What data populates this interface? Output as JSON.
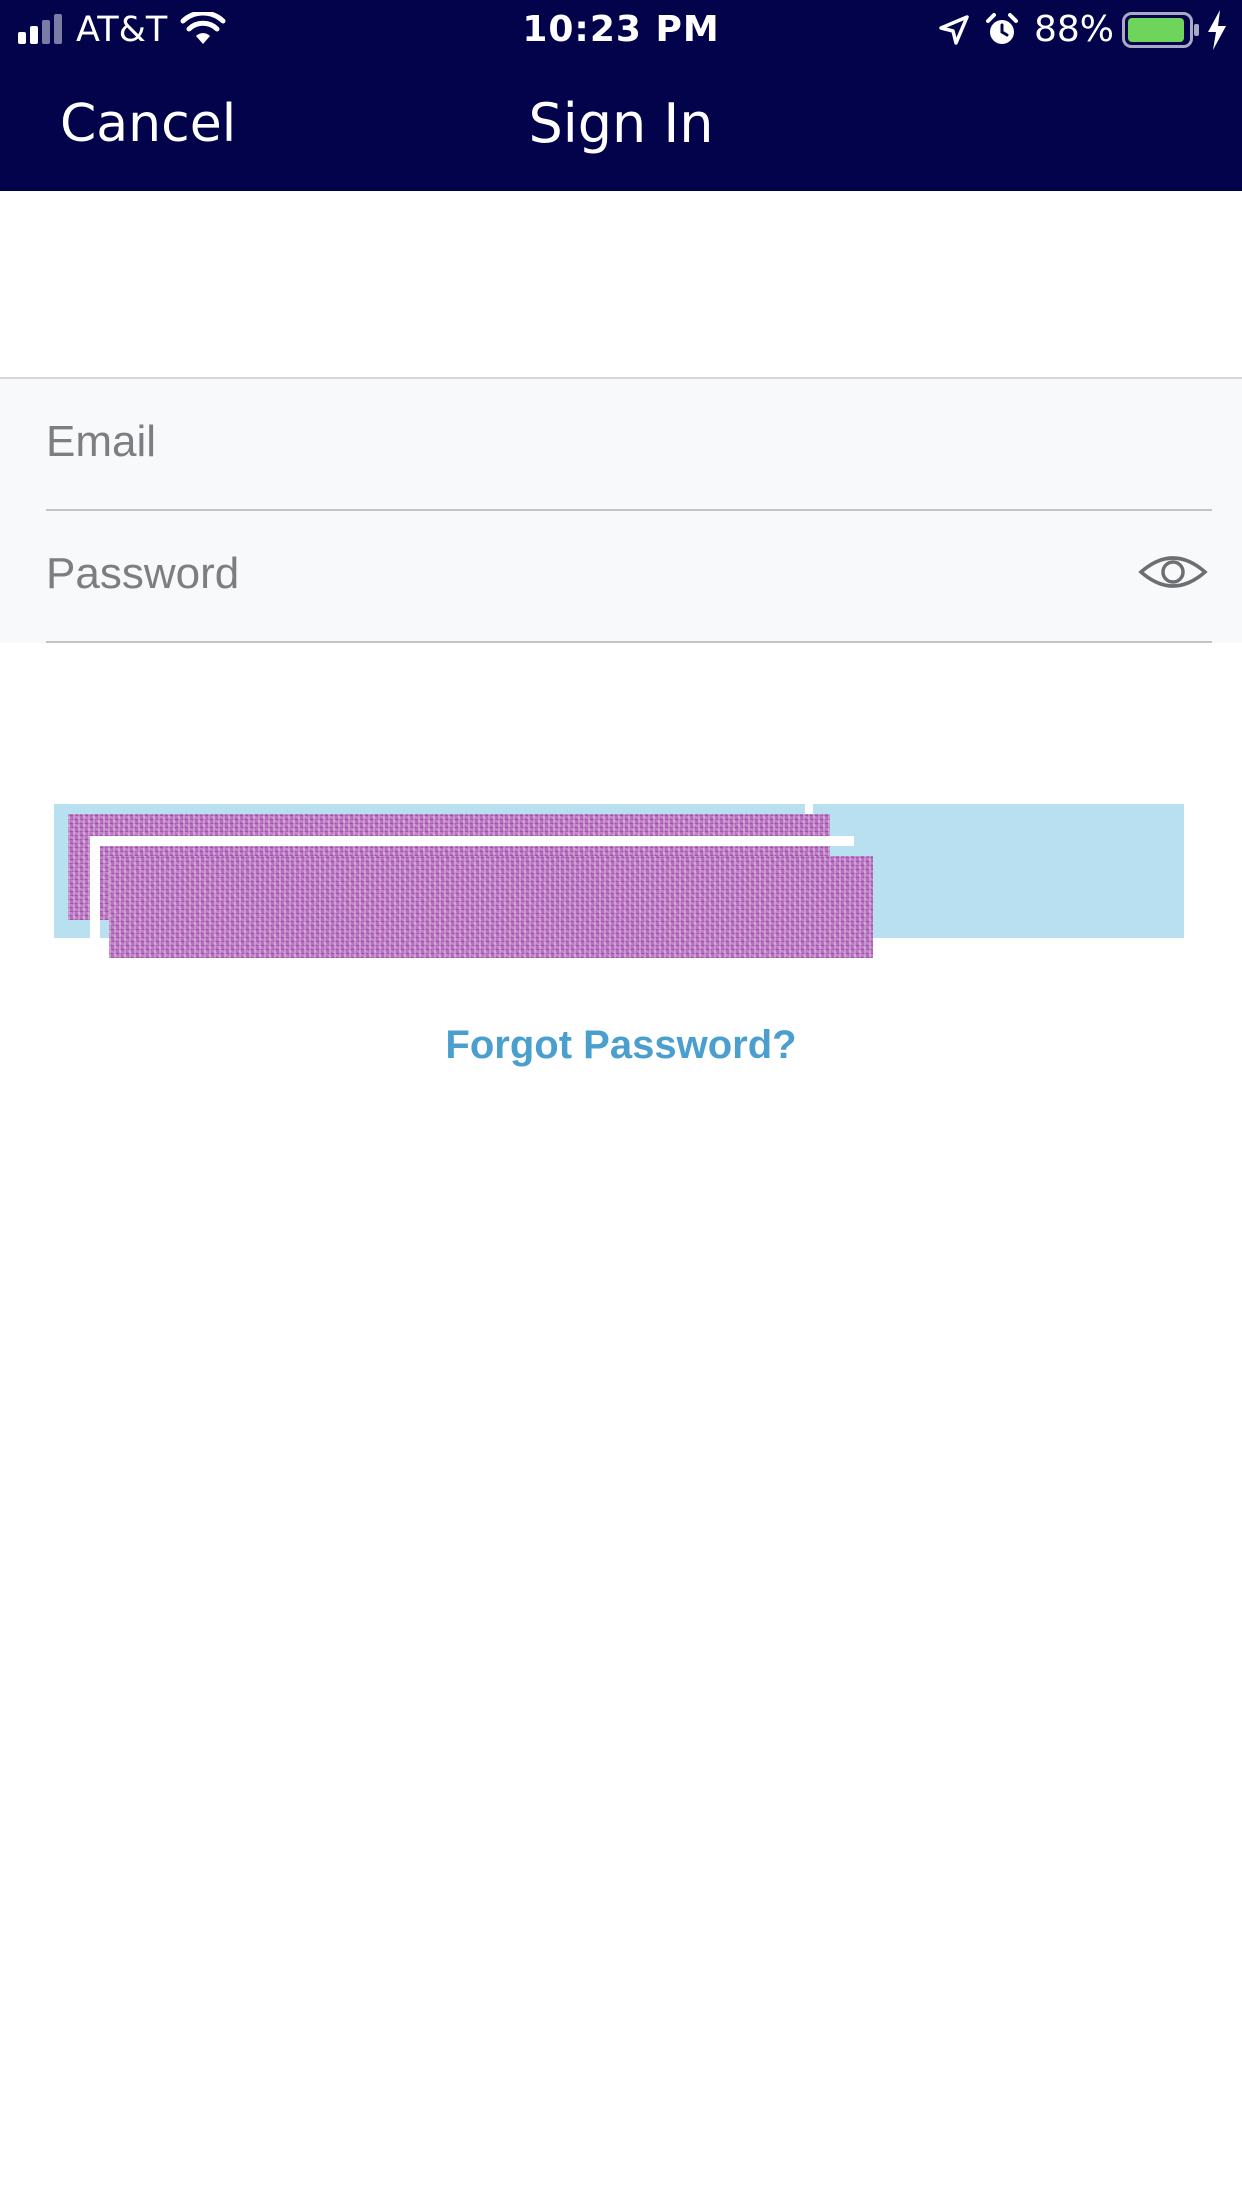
{
  "status_bar": {
    "carrier": "AT&T",
    "time": "10:23 PM",
    "battery_percent": "88%",
    "icons": [
      "signal-icon",
      "wifi-icon",
      "location-icon",
      "alarm-icon",
      "battery-icon",
      "charging-icon"
    ]
  },
  "nav": {
    "cancel_label": "Cancel",
    "title": "Sign In"
  },
  "form": {
    "email_placeholder": "Email",
    "password_placeholder": "Password",
    "show_password_icon": "eye-icon"
  },
  "actions": {
    "sign_in_button": "redacted",
    "forgot_label": "Forgot Password?"
  },
  "colors": {
    "nav_background": "#02034a",
    "link": "#4a9fcf",
    "button_background": "#b9e0f1",
    "battery_fill": "#6fd45c"
  }
}
